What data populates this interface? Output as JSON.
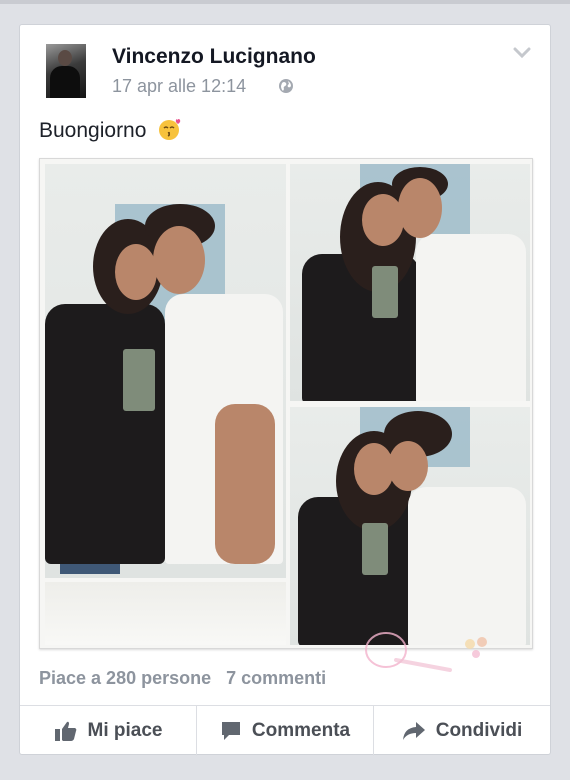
{
  "post": {
    "author": "Vincenzo Lucignano",
    "timestamp": "17 apr alle 12:14",
    "privacy_icon": "globe-icon",
    "menu_icon": "chevron-down-icon",
    "text": "Buongiorno",
    "emoji_icon": "kiss-face-emoji"
  },
  "stats": {
    "likes": "Piace a 280 persone",
    "comments": "7 commenti"
  },
  "actions": {
    "like_label": "Mi piace",
    "comment_label": "Commenta",
    "share_label": "Condividi"
  },
  "colors": {
    "background": "#dfe1e6",
    "card": "#ffffff",
    "author": "#141823",
    "muted": "#8d949e",
    "action_text": "#4b4f56"
  }
}
